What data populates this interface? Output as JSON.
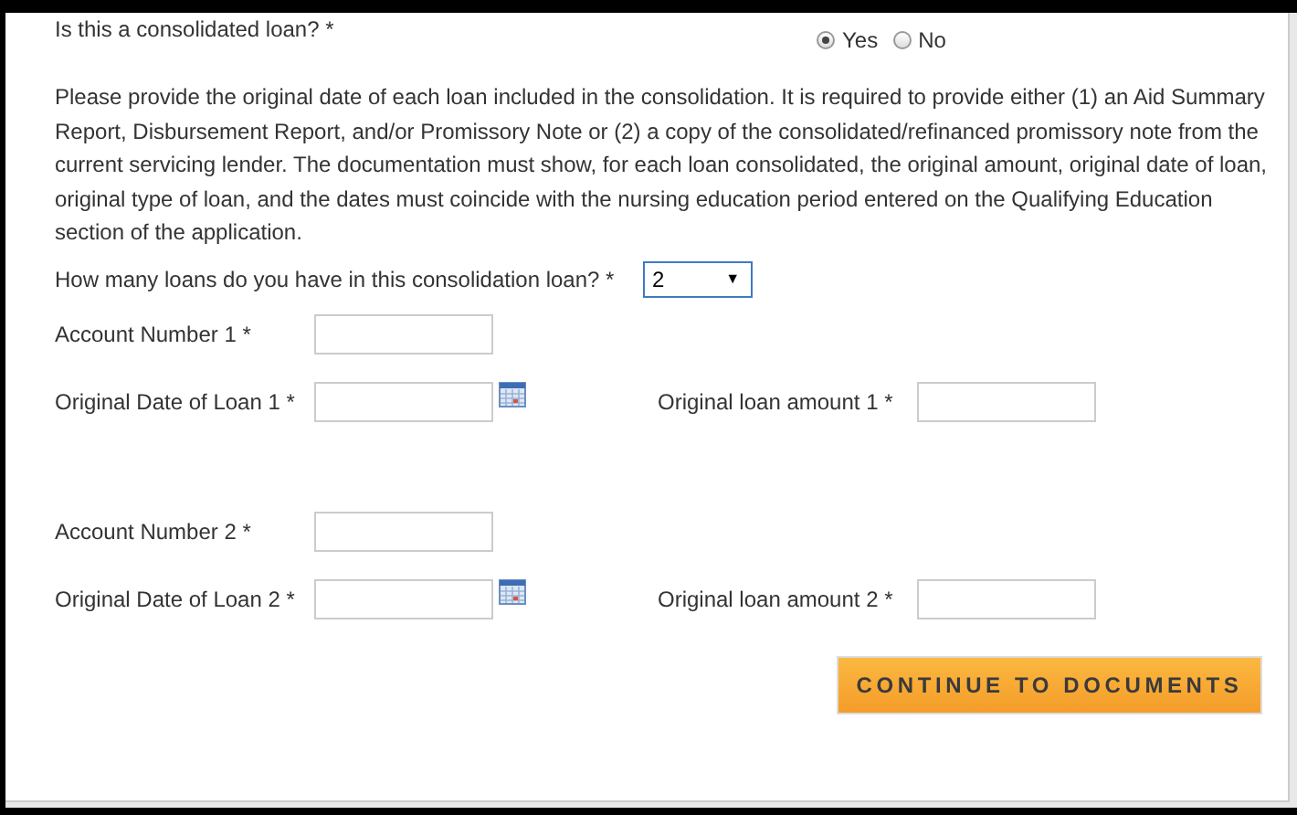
{
  "consolidated": {
    "question": "Is this a consolidated loan? *",
    "options": [
      {
        "label": "Yes",
        "selected": true
      },
      {
        "label": "No",
        "selected": false
      }
    ]
  },
  "instructions": "Please provide the original date of each loan included in the consolidation. It is required to provide either (1) an Aid Summary Report, Disbursement Report, and/or Promissory Note or (2) a copy of the consolidated/refinanced promissory note from the current servicing lender. The documentation must show, for each loan consolidated, the original amount, original date of loan, original type of loan, and the dates must coincide with the nursing education period entered on the Qualifying Education section of the application.",
  "loan_count": {
    "label": "How many loans do you have in this consolidation loan? *",
    "value": "2",
    "arrow": "▼"
  },
  "loans": [
    {
      "account_label": "Account Number 1 *",
      "date_label": "Original Date of Loan 1 *",
      "amount_label": "Original loan amount 1 *"
    },
    {
      "account_label": "Account Number 2 *",
      "date_label": "Original Date of Loan 2 *",
      "amount_label": "Original loan amount 2 *"
    }
  ],
  "button": "CONTINUE TO DOCUMENTS"
}
